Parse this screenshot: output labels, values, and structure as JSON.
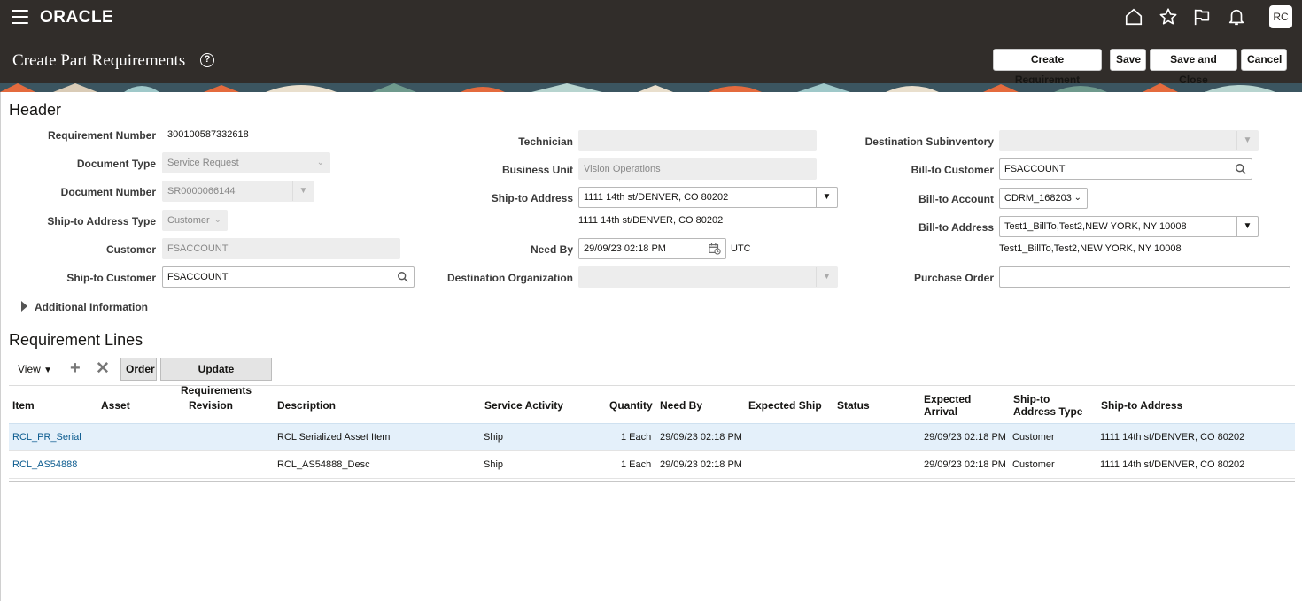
{
  "app": {
    "brand": "ORACLE",
    "user_initials": "RC"
  },
  "page": {
    "title": "Create Part Requirements"
  },
  "actions": {
    "create_requirement": "Create Requirement",
    "save": "Save",
    "save_and_close": "Save and Close",
    "cancel": "Cancel"
  },
  "header": {
    "title": "Header",
    "requirement_number": {
      "label": "Requirement Number",
      "value": "300100587332618"
    },
    "document_type": {
      "label": "Document Type",
      "value": "Service Request"
    },
    "document_number": {
      "label": "Document Number",
      "value": "SR0000066144"
    },
    "ship_to_address_type": {
      "label": "Ship-to Address Type",
      "value": "Customer"
    },
    "customer": {
      "label": "Customer",
      "value": "FSACCOUNT"
    },
    "ship_to_customer": {
      "label": "Ship-to Customer",
      "value": "FSACCOUNT"
    },
    "technician": {
      "label": "Technician",
      "value": ""
    },
    "business_unit": {
      "label": "Business Unit",
      "value": "Vision Operations"
    },
    "ship_to_address": {
      "label": "Ship-to Address",
      "value": "1111 14th st/DENVER, CO 80202",
      "display": "1111 14th st/DENVER, CO 80202"
    },
    "need_by": {
      "label": "Need By",
      "value": "29/09/23 02:18 PM",
      "timezone": "UTC"
    },
    "destination_organization": {
      "label": "Destination Organization",
      "value": ""
    },
    "destination_subinventory": {
      "label": "Destination Subinventory",
      "value": ""
    },
    "bill_to_customer": {
      "label": "Bill-to Customer",
      "value": "FSACCOUNT"
    },
    "bill_to_account": {
      "label": "Bill-to Account",
      "value": "CDRM_168203"
    },
    "bill_to_address": {
      "label": "Bill-to Address",
      "value": "Test1_BillTo,Test2,NEW YORK, NY 10008",
      "display": "Test1_BillTo,Test2,NEW YORK, NY 10008"
    },
    "purchase_order": {
      "label": "Purchase Order",
      "value": ""
    },
    "additional_information": "Additional Information"
  },
  "lines": {
    "title": "Requirement Lines",
    "toolbar": {
      "view": "View",
      "order": "Order",
      "update": "Update Requirements"
    },
    "columns": {
      "item": "Item",
      "asset": "Asset",
      "revision": "Revision",
      "description": "Description",
      "service_activity": "Service Activity",
      "quantity": "Quantity",
      "need_by": "Need By",
      "expected_ship": "Expected Ship",
      "status": "Status",
      "expected_arrival_1": "Expected",
      "expected_arrival_2": "Arrival",
      "ship_to_type_1": "Ship-to",
      "ship_to_type_2": "Address Type",
      "ship_to_address": "Ship-to Address"
    },
    "rows": [
      {
        "item": "RCL_PR_Serial",
        "asset": "",
        "revision": "",
        "description": "RCL Serialized Asset Item",
        "service_activity": "Ship",
        "quantity": "1 Each",
        "need_by": "29/09/23 02:18 PM",
        "expected_ship": "",
        "status": "",
        "expected_arrival": "29/09/23 02:18 PM",
        "ship_to_type": "Customer",
        "ship_to_address": "1111 14th st/DENVER, CO 80202"
      },
      {
        "item": "RCL_AS54888",
        "asset": "",
        "revision": "",
        "description": "RCL_AS54888_Desc",
        "service_activity": "Ship",
        "quantity": "1 Each",
        "need_by": "29/09/23 02:18 PM",
        "expected_ship": "",
        "status": "",
        "expected_arrival": "29/09/23 02:18 PM",
        "ship_to_type": "Customer",
        "ship_to_address": "1111 14th st/DENVER, CO 80202"
      }
    ]
  },
  "colors": {
    "header_bg": "#312d2a",
    "link": "#0b5b8f",
    "selected_row": "#e4f0fa"
  }
}
